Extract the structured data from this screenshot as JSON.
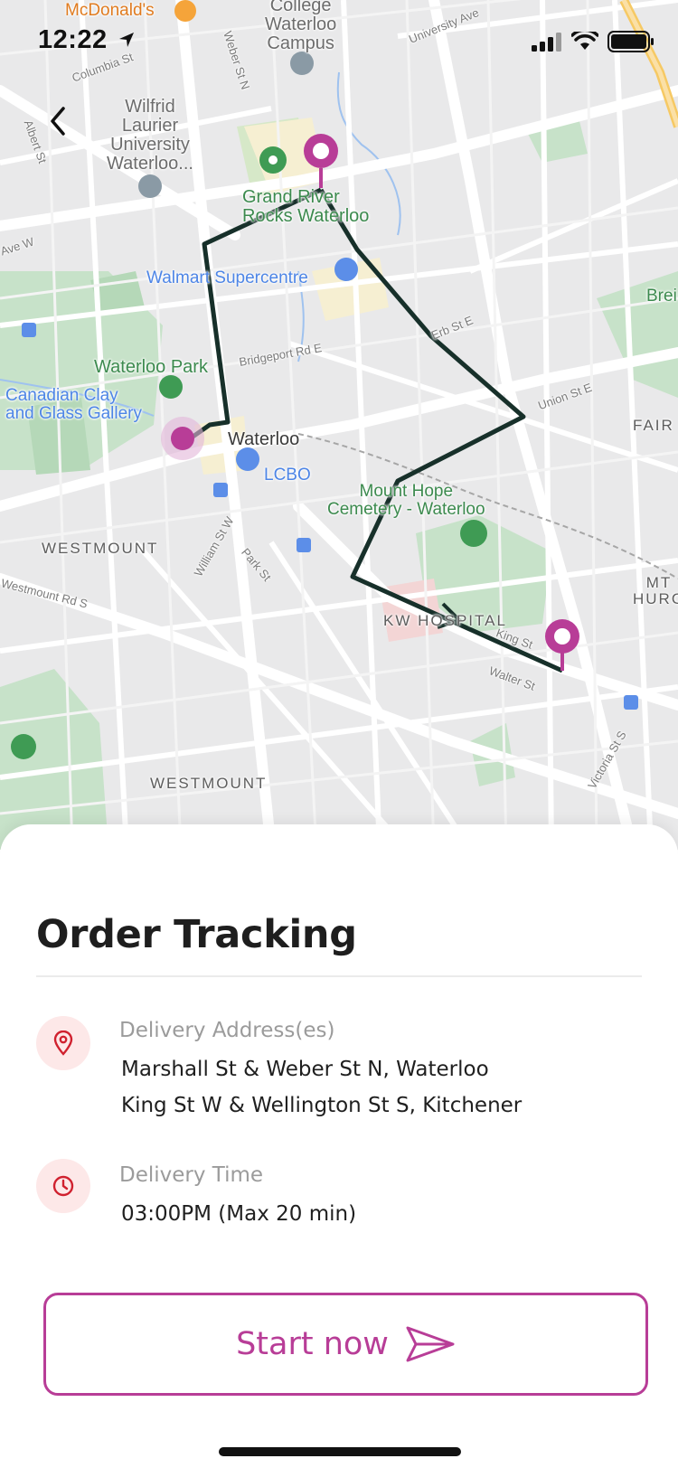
{
  "status_bar": {
    "time": "12:22",
    "icons": [
      "location-arrow-icon",
      "signal-icon",
      "wifi-icon",
      "battery-icon"
    ]
  },
  "map": {
    "places": {
      "mcdonalds": "McDonald's",
      "waterloo_campus": "College\nWaterloo\nCampus",
      "wilfrid_laurier": "Wilfrid\nLaurier\nUniversity\nWaterloo...",
      "grand_river_rocks": "Grand River\nRocks Waterloo",
      "walmart": "Walmart Supercentre",
      "waterloo_park": "Waterloo Park",
      "canadian_clay": "Canadian Clay\nand Glass Gallery",
      "waterloo": "Waterloo",
      "lcbo": "LCBO",
      "mount_hope": "Mount Hope\nCemetery - Waterloo",
      "kw_hospital": "KW HOSPITAL",
      "westmount_1": "WESTMOUNT",
      "westmount_2": "WESTMOUNT",
      "mt_hope_hur": "MT\nHURO",
      "fair": "FAIR",
      "brei": "Brei"
    },
    "streets": {
      "columbia": "Columbia St",
      "albert": "Albert St",
      "weber": "Weber St N",
      "university": "University Ave",
      "bridgeport": "Bridgeport Rd E",
      "erb": "Erb St E",
      "union": "Union St E",
      "william": "William St W",
      "park": "Park St",
      "westmount_rd": "Westmount Rd S",
      "king": "King St",
      "walter": "Walter St",
      "victoria": "Victoria St S",
      "ave_w": "Ave W"
    },
    "route_color": "#17302a",
    "pin_color": "#b83d97"
  },
  "sheet": {
    "title": "Order Tracking",
    "address_label": "Delivery Address(es)",
    "addresses": [
      "Marshall St & Weber St N, Waterloo",
      "King St W & Wellington St S, Kitchener"
    ],
    "time_label": "Delivery Time",
    "time_value": "03:00PM (Max 20 min)",
    "start_button": "Start now",
    "accent_color": "#b83d97",
    "icon_color": "#d0212f"
  }
}
